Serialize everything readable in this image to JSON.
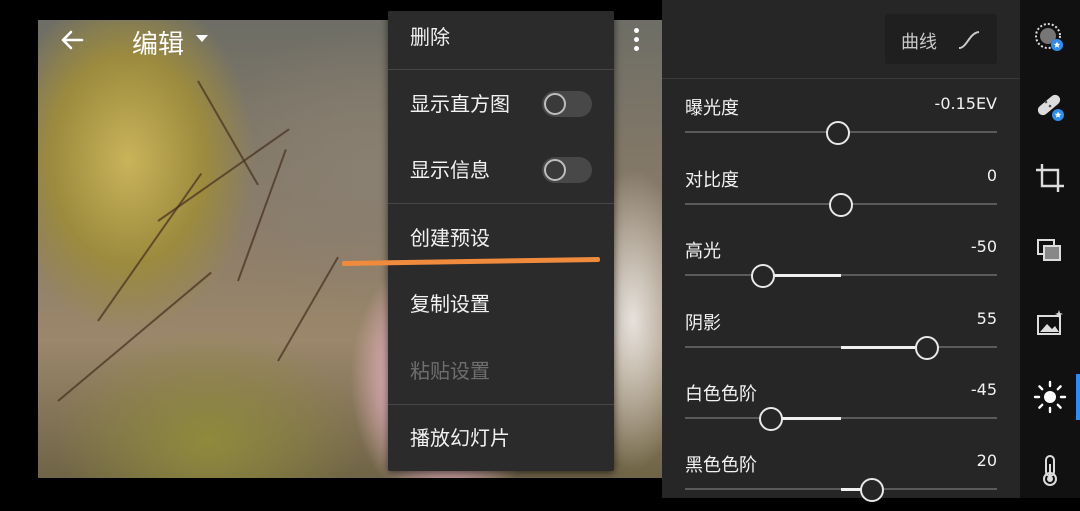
{
  "header": {
    "title": "编辑"
  },
  "menu": {
    "items": [
      {
        "label": "删除"
      },
      {
        "label": "显示直方图"
      },
      {
        "label": "显示信息"
      },
      {
        "label": "创建预设"
      },
      {
        "label": "复制设置"
      },
      {
        "label": "粘贴设置"
      },
      {
        "label": "播放幻灯片"
      }
    ],
    "toggles": {
      "histogram": false,
      "info": false
    }
  },
  "panel": {
    "curve_label": "曲线",
    "sliders": [
      {
        "name": "曝光度",
        "value": "-0.15EV",
        "position": 0.49
      },
      {
        "name": "对比度",
        "value": "0",
        "position": 0.5
      },
      {
        "name": "高光",
        "value": "-50",
        "position": 0.25
      },
      {
        "name": "阴影",
        "value": "55",
        "position": 0.775
      },
      {
        "name": "白色色阶",
        "value": "-45",
        "position": 0.275
      },
      {
        "name": "黑色色阶",
        "value": "20",
        "position": 0.6
      }
    ]
  },
  "rail": {
    "icons": [
      "auto-enhance-icon",
      "healing-bandage-icon",
      "crop-icon",
      "layers-icon",
      "image-effects-icon",
      "light-icon",
      "temperature-icon"
    ],
    "active": "light-icon",
    "accent": "#2d8ef0"
  },
  "annotation_color": "#f08a3c"
}
